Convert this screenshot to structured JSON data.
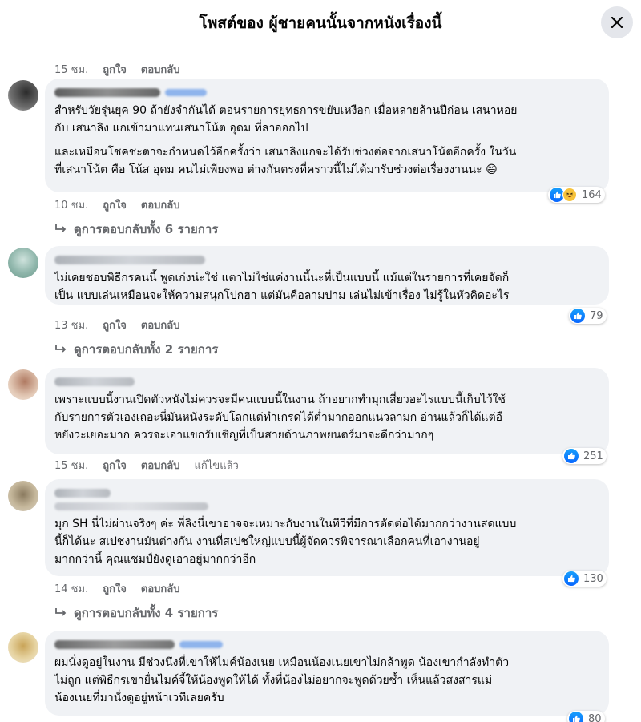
{
  "header": {
    "title": "โพสต์ของ ผู้ชายคนนั้นจากหนังเรื่องนี้"
  },
  "partial": {
    "time": "15 ชม.",
    "like": "ถูกใจ",
    "reply": "ตอบกลับ"
  },
  "comments": [
    {
      "paragraphs": [
        "สำหรับวัยรุ่นยุค 90 ถ้ายังจำกันได้ ตอนรายการยุทธการขยับเหงือก เมื่อหลายล้านปีก่อน เสนาหอย\nกับ เสนาลิง แกเข้ามาแทนเสนาโน้ต อุดม ที่ลาออกไป",
        "และเหมือนโชคชะตาจะกำหนดไว้อีกครั้งว่า เสนาลิงแกจะได้รับช่วงต่อจากเสนาโน้ตอีกครั้ง ในวัน\nที่เสนาโน้ต คือ โน้ส อุดม คนไม่เพียงพอ ต่างกันตรงที่คราวนี้ไม่ได้มารับช่วงต่อเรื่องงานนะ 😄"
      ],
      "time": "10 ชม.",
      "like": "ถูกใจ",
      "reply": "ตอบกลับ",
      "edited": "",
      "reaction_count": "164",
      "replies_label": "ดูการตอบกลับทั้ง 6 รายการ"
    },
    {
      "paragraphs": [
        "ไม่เคยชอบพิธีกรคนนี้ พูดเก่งน่ะใช่ แตาไม่ใช่แค่งานนี้นะที่เป็นแบบนี้ แม้แต่ในรายการที่เคยจัดก็\nเป็น แบบเล่นเหมือนจะให้ความสนุกโปกฮา แต่มันคือลามปาม เล่นไม่เข้าเรื่อง ไม่รู้ในหัวคิดอะไร"
      ],
      "time": "13 ชม.",
      "like": "ถูกใจ",
      "reply": "ตอบกลับ",
      "edited": "",
      "reaction_count": "79",
      "replies_label": "ดูการตอบกลับทั้ง 2 รายการ"
    },
    {
      "paragraphs": [
        "เพราะแบบนี้งานเปิดตัวหนังไม่ควรจะมีคนแบบนี้ในงาน ถ้าอยากทำมุกเสี่ยวอะไรแบบนี้เก็บไว้ใช้\nกับรายการตัวเองเถอะนี่มันหนังระดับโลกแต่ทำเกรดได้ต่ำมากออกแนวลามก อ่านแล้วก็ได้แต่อื\nหยังวะเยอะมาก ควรจะเอาแขกรับเชิญที่เป็นสายด้านภาพยนตร์มาจะดีกว่ามากๆ"
      ],
      "time": "15 ชม.",
      "like": "ถูกใจ",
      "reply": "ตอบกลับ",
      "edited": "แก้ไขแล้ว",
      "reaction_count": "251",
      "replies_label": ""
    },
    {
      "paragraphs": [
        "มุก SH นี่ไม่ผ่านจริงๆ ค่ะ พี่ลิงนี่เขาอาจจะเหมาะกับงานในทีวีที่มีการตัดต่อได้มากกว่างานสดแบบ\nนี้ก็ได้นะ สเปชงานมันต่างกัน งานที่สเปชใหญ่แบบนี้ผู้จัดควรพิจารณาเลือกคนที่เอางานอยู่\nมากกว่านี้ คุณแชมป์ยังดูเอาอยู่มากกว่าอีก"
      ],
      "time": "14 ชม.",
      "like": "ถูกใจ",
      "reply": "ตอบกลับ",
      "edited": "",
      "reaction_count": "130",
      "replies_label": "ดูการตอบกลับทั้ง 4 รายการ"
    },
    {
      "paragraphs": [
        "ผมนั่งดูอยู่ในงาน มีช่วงนึงที่เขาให้ไมค์น้องเนย เหมือนน้องเนยเขาไม่กล้าพูด น้องเขากำลังทำตัว\nไม่ถูก แต่พิธีกรเขายื่นไมค์จี้ให้น้องพูดให้ได้ ทั้งที่น้องไม่อยากจะพูดด้วยซ้ำ เห็นแล้วสงสารแม่\nน้องเนยที่มานั่งดูอยู่หน้าเวทีเลยครับ"
      ],
      "time": "",
      "like": "",
      "reply": "",
      "edited": "",
      "reaction_count": "80",
      "replies_label": ""
    }
  ],
  "colors": {
    "bubble": "#f0f2f5",
    "meta": "#65676b",
    "like_blue": "#0866ff",
    "haha_yellow": "#f7c33b"
  },
  "icons": {
    "close": "close-icon",
    "like": "like-icon",
    "haha": "haha-icon",
    "reply_arrow": "reply-arrow-icon"
  }
}
